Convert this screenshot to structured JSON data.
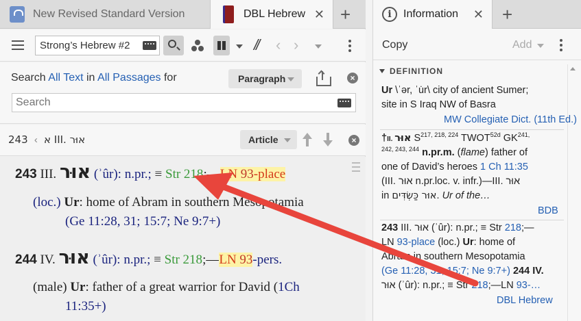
{
  "tabs": {
    "left": [
      {
        "label": "New Revised Standard Version",
        "active": false
      },
      {
        "label": "DBL Hebrew",
        "active": true
      }
    ],
    "right": [
      {
        "label": "Information",
        "active": true
      }
    ]
  },
  "toolbar": {
    "resource_value": "Strong’s Hebrew #2",
    "slashes": "//",
    "back": "‹",
    "forward": "›"
  },
  "search": {
    "prefix": "Search",
    "scope1": "All Text",
    "in": "in",
    "scope2": "All Passages",
    "for": "for",
    "view_mode": "Paragraph",
    "placeholder": "Search"
  },
  "breadcrumb": {
    "root": "א",
    "sep": "›",
    "current": "243 III. אוּר",
    "view_button": "Article"
  },
  "entries": [
    {
      "number": "243",
      "roman": "III.",
      "hebrew": "אוּר",
      "translit": " (ʾûr): ",
      "pos": "n.pr.;",
      "equiv": " ≡ ",
      "strong": "Str 218",
      "sep": ";—",
      "ln_label": "LN ",
      "ln_num": "93",
      "ln_rest": "-place",
      "gloss_open": "(loc.) ",
      "gloss_word": "Ur",
      "gloss_text": ": home of Abram in southern Mesopotamia",
      "refs": "(Ge 11:28, 31; 15:7; Ne 9:7+)"
    },
    {
      "number": "244",
      "roman": "IV.",
      "hebrew": "אוּר",
      "translit": " (ʾûr): ",
      "pos": "n.pr.;",
      "equiv": " ≡ ",
      "strong": "Str 218",
      "sep": ";—",
      "ln_label": "LN ",
      "ln_num": "93",
      "ln_rest": "-pers.",
      "gloss_open": "(male) ",
      "gloss_word": "Ur",
      "gloss_text": ": father of a great warrior for David (",
      "refs_inline": "1Ch",
      "refs_line2": "11:35+)"
    }
  ],
  "info": {
    "copy": "Copy",
    "add": "Add",
    "section": "DEFINITION",
    "mw": {
      "line1_bold": "Ur",
      "line1": " \\ˈər, ˈu̇r\\ city of ancient Sumer;",
      "line2": "site in S Iraq NW of Basra",
      "source": "MW Collegiate Dict. (11th Ed.)"
    },
    "bdb": {
      "l1a": "†",
      "l1b": "II. ",
      "l1c": "אוּר",
      "l1d": " S",
      "l1e": "217, 218, 224",
      "l1f": " TWOT",
      "l1g": "52d",
      "l1h": " GK",
      "l1i": "241,",
      "l2a": "242, 243, 244",
      "l2b": " n.pr.m.",
      "l2c": " (",
      "l2d": "flame",
      "l2e": ") father of",
      "l3a": "one of David’s heroes ",
      "l3b": "1 Ch 11:35",
      "l4": "(III. אוּר n.pr.loc. v. infr.)—III. אוּר",
      "l5a": "in ",
      "l5b": "אוּר כַּשְׂדִּים",
      "l5c": ". ",
      "l5d": "Ur of the…",
      "source": "BDB"
    },
    "dbl": {
      "l1a": "243",
      "l1b": " III. אוּר (ʾûr): n.pr.; ≡ Str ",
      "l1c": "218",
      "l1d": ";—",
      "l2a": "LN ",
      "l2b": "93-place",
      "l2c": " (loc.) ",
      "l2d": "Ur",
      "l2e": ": home of",
      "l3": "Abram in southern Mesopotamia",
      "l4a": "(Ge 11:28, 31; 15:7; Ne 9:7+) ",
      "l4b": "244",
      "l4c": " IV.",
      "l5a": "אוּר (ʾûr): n.pr.; ≡ Str ",
      "l5b": "218",
      "l5c": ";—LN ",
      "l5d": "93-…",
      "source": "DBL Hebrew"
    }
  },
  "colors": {
    "annotation_arrow": "#e8453c",
    "link": "#2560b3",
    "strong_green": "#3a9a3a",
    "ln_highlight": "#fdf3a6"
  }
}
